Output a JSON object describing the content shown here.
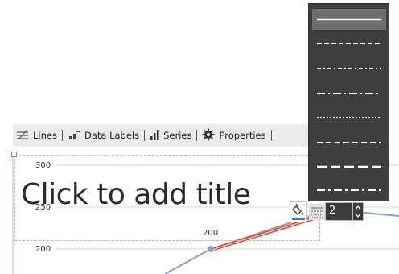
{
  "toolbar": {
    "lines_label": "Lines",
    "data_labels_label": "Data Labels",
    "series_label": "Series",
    "properties_label": "Properties"
  },
  "title_placeholder": "Click to add title",
  "chart_data": {
    "type": "line",
    "yticks": [
      "300",
      "250",
      "200"
    ],
    "data_labels": [
      "200"
    ],
    "series": [
      {
        "values": [
          200
        ]
      }
    ]
  },
  "dash_menu": {
    "options": [
      "solid",
      "dash",
      "dash-dot-dot",
      "dash-dot",
      "dot",
      "long-dash",
      "long-dash-heavy",
      "long-dash-dot"
    ],
    "selected": "solid"
  },
  "line_width": {
    "value": "2",
    "icons": [
      "paint-bucket-icon",
      "dash-style-icon",
      "spin-icon"
    ]
  },
  "colors": {
    "series_line": "#8aa0c6",
    "selected_segment": "#d9472b",
    "menu_bg": "#3f3f3f",
    "toolbar_bg": "#ebebeb"
  }
}
